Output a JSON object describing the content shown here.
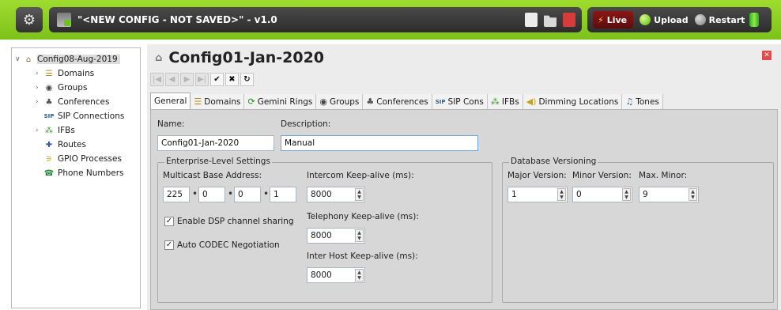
{
  "topbar": {
    "window_title": "\"<NEW CONFIG - NOT SAVED>\" - v1.0",
    "live_label": "Live",
    "upload_label": "Upload",
    "restart_label": "Restart"
  },
  "tree": {
    "root_label": "Config08-Aug-2019",
    "items": [
      {
        "label": "Domains",
        "icon": "domains-icon"
      },
      {
        "label": "Groups",
        "icon": "groups-icon"
      },
      {
        "label": "Conferences",
        "icon": "conferences-icon"
      },
      {
        "label": "SIP Connections",
        "icon": "sip-icon"
      },
      {
        "label": "IFBs",
        "icon": "ifbs-icon"
      },
      {
        "label": "Routes",
        "icon": "routes-icon"
      },
      {
        "label": "GPIO Processes",
        "icon": "gpio-icon"
      },
      {
        "label": "Phone Numbers",
        "icon": "phone-icon"
      }
    ]
  },
  "main": {
    "title": "Config01-Jan-2020",
    "tabs": [
      {
        "label": "General",
        "icon": ""
      },
      {
        "label": "Domains",
        "icon": "domains-icon"
      },
      {
        "label": "Gemini Rings",
        "icon": "rings-icon"
      },
      {
        "label": "Groups",
        "icon": "groups-icon"
      },
      {
        "label": "Conferences",
        "icon": "conferences-icon"
      },
      {
        "label": "SIP Cons",
        "icon": "sip-icon"
      },
      {
        "label": "IFBs",
        "icon": "ifbs-icon"
      },
      {
        "label": "Dimming Locations",
        "icon": "speaker-icon"
      },
      {
        "label": "Tones",
        "icon": "tones-icon"
      }
    ]
  },
  "general": {
    "name_label": "Name:",
    "name_value": "Config01-Jan-2020",
    "description_label": "Description:",
    "description_value": "Manual",
    "enterprise": {
      "title": "Enterprise-Level Settings",
      "multicast_label": "Multicast Base Address:",
      "octets": [
        "225",
        "0",
        "0",
        "1"
      ],
      "dsp_label": "Enable DSP channel sharing",
      "codec_label": "Auto CODEC Negotiation",
      "intercom_label": "Intercom Keep-alive (ms):",
      "intercom_value": "8000",
      "telephony_label": "Telephony Keep-alive (ms):",
      "telephony_value": "8000",
      "interhost_label": "Inter Host Keep-alive (ms):",
      "interhost_value": "8000"
    },
    "versioning": {
      "title": "Database Versioning",
      "major_label": "Major Version:",
      "major_value": "1",
      "minor_label": "Minor Version:",
      "minor_value": "0",
      "maxminor_label": "Max. Minor:",
      "maxminor_value": "9"
    }
  }
}
